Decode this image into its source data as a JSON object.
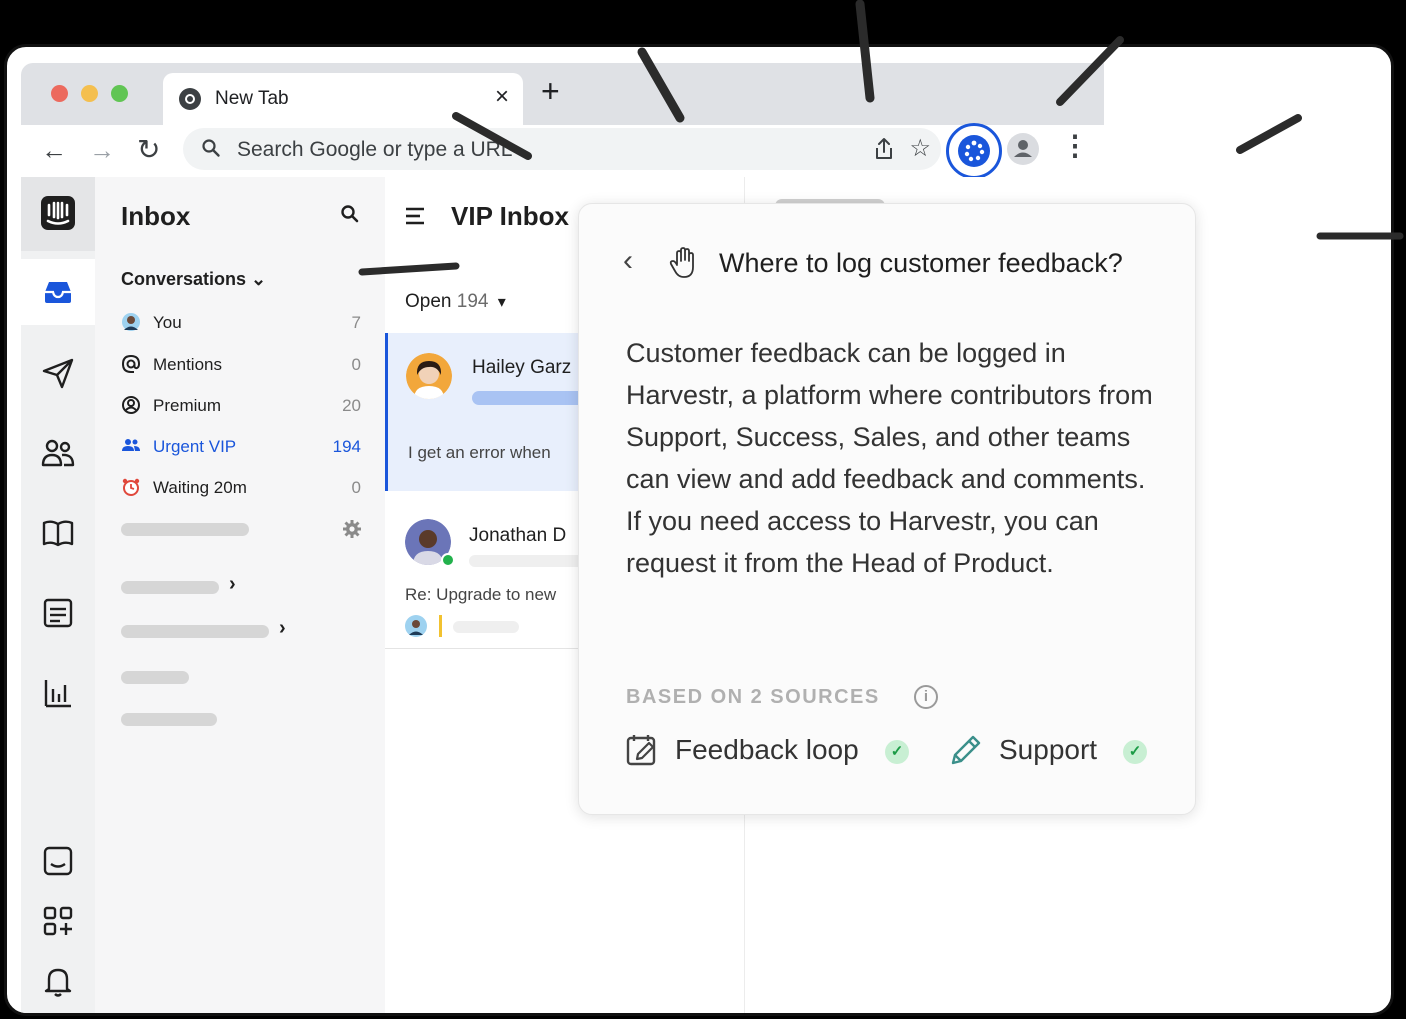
{
  "browser": {
    "tab_title": "New Tab",
    "tab_close": "×",
    "new_tab": "+",
    "nav_back": "←",
    "nav_forward": "→",
    "nav_reload": "↻",
    "omnibox_placeholder": "Search Google or type a URL",
    "star": "☆",
    "menu": "⋮",
    "traffic_colors": [
      "#ec6a5e",
      "#f4bf4f",
      "#61c554"
    ]
  },
  "sidebar": {
    "title": "Inbox",
    "conversations_label": "Conversations ⌄",
    "items": [
      {
        "label": "You",
        "count": "7",
        "icon": "avatar-icon"
      },
      {
        "label": "Mentions",
        "count": "0",
        "icon": "at-icon"
      },
      {
        "label": "Premium",
        "count": "20",
        "icon": "user-circle-icon"
      },
      {
        "label": "Urgent VIP",
        "count": "194",
        "icon": "team-icon",
        "active": true
      },
      {
        "label": "Waiting 20m",
        "count": "0",
        "icon": "alarm-clock-icon"
      }
    ],
    "chevron": "›"
  },
  "list": {
    "title": "VIP Inbox",
    "filter_label": "Open",
    "filter_count": "194",
    "filter_caret": "▾",
    "conversations": [
      {
        "name": "Hailey Garz",
        "preview": "I get an error when"
      },
      {
        "name": "Jonathan D",
        "preview": "Re: Upgrade to new"
      }
    ]
  },
  "popup": {
    "back": "‹",
    "title": "Where to log customer feedback?",
    "body": "Customer feedback can be logged in Harvestr, a platform where contributors from Support, Success, Sales, and other teams can view and add feedback and comments. If you need access to Harvestr, you can request it from the Head of Product.",
    "sources_label": "BASED ON 2 SOURCES",
    "info": "i",
    "sources": [
      {
        "label": "Feedback loop",
        "icon": "calendar-edit-icon",
        "check": "✓"
      },
      {
        "label": "Support",
        "icon": "pencil-icon",
        "check": "✓"
      }
    ]
  },
  "colors": {
    "accent": "#1a56db",
    "success": "#1b9b46"
  }
}
